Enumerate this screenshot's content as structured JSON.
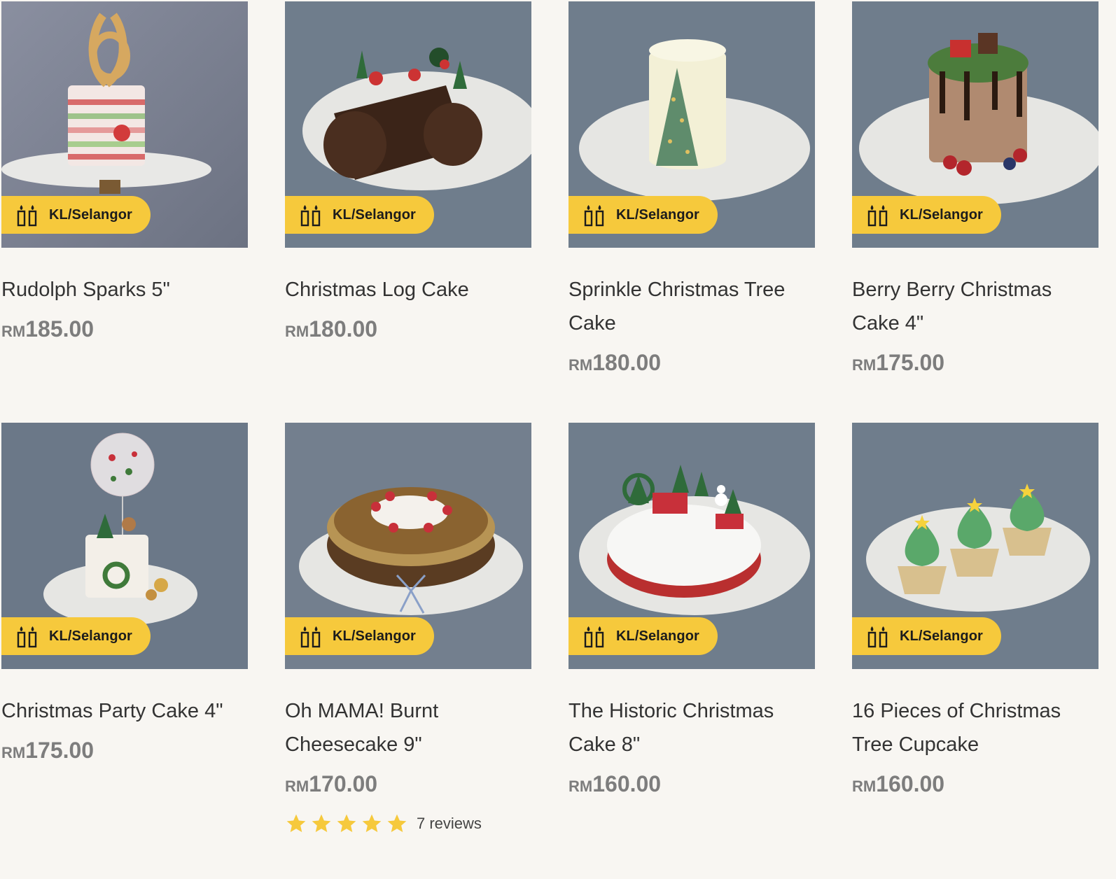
{
  "colors": {
    "page_bg": "#f8f6f2",
    "badge_bg": "#f6c93c",
    "title_text": "#333333",
    "price_text": "#7d7d7d",
    "star": "#f6c93c"
  },
  "badge_icon": "candles-icon",
  "products": [
    {
      "name": "Rudolph Sparks 5\"",
      "currency": "RM",
      "price": "185.00",
      "badge": "KL/Selangor",
      "image": "reindeer-cake"
    },
    {
      "name": "Christmas Log Cake",
      "currency": "RM",
      "price": "180.00",
      "badge": "KL/Selangor",
      "image": "log-cake"
    },
    {
      "name": "Sprinkle Christmas Tree Cake",
      "currency": "RM",
      "price": "180.00",
      "badge": "KL/Selangor",
      "image": "tree-cake"
    },
    {
      "name": "Berry Berry Christmas Cake 4\"",
      "currency": "RM",
      "price": "175.00",
      "badge": "KL/Selangor",
      "image": "berry-cake"
    },
    {
      "name": "Christmas Party Cake 4\"",
      "currency": "RM",
      "price": "175.00",
      "badge": "KL/Selangor",
      "image": "balloon-cake"
    },
    {
      "name": "Oh MAMA! Burnt Cheesecake 9\"",
      "currency": "RM",
      "price": "170.00",
      "badge": "KL/Selangor",
      "image": "cheesecake",
      "rating": 5,
      "reviews": "7 reviews"
    },
    {
      "name": "The Historic Christmas Cake 8\"",
      "currency": "RM",
      "price": "160.00",
      "badge": "KL/Selangor",
      "image": "snow-cake"
    },
    {
      "name": "16 Pieces of Christmas Tree Cupcake",
      "currency": "RM",
      "price": "160.00",
      "badge": "KL/Selangor",
      "image": "cupcakes"
    }
  ]
}
